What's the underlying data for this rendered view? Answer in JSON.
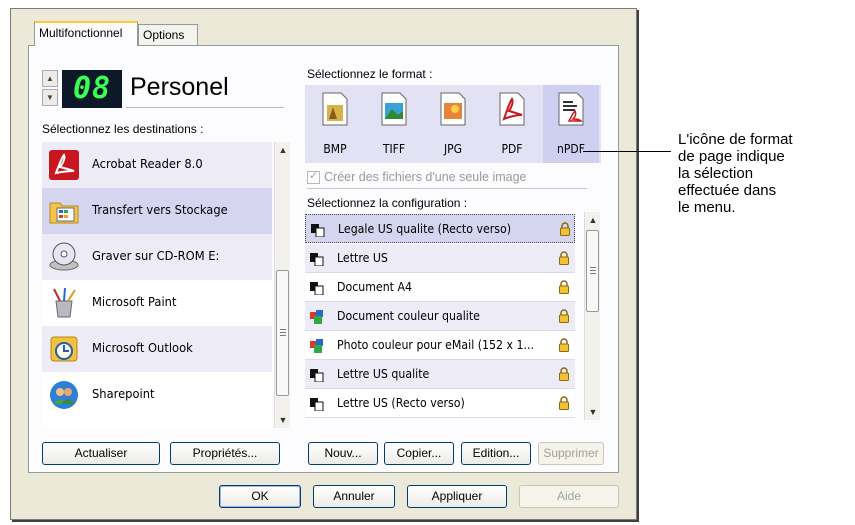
{
  "tabs": [
    "Multifonctionnel",
    "Options"
  ],
  "profile": {
    "number": "08",
    "name": "Personel"
  },
  "destinations": {
    "label": "Sélectionnez les destinations :",
    "items": [
      {
        "label": "Acrobat Reader 8.0",
        "icon": "acrobat-reader-icon"
      },
      {
        "label": "Transfert vers Stockage",
        "icon": "transfer-to-storage-icon"
      },
      {
        "label": "Graver sur CD-ROM  E:",
        "icon": "cd-burner-icon"
      },
      {
        "label": "Microsoft Paint",
        "icon": "paint-icon"
      },
      {
        "label": "Microsoft Outlook",
        "icon": "outlook-icon"
      },
      {
        "label": "Sharepoint",
        "icon": "sharepoint-icon"
      }
    ],
    "selected": "Transfert vers Stockage"
  },
  "format": {
    "label": "Sélectionnez le format :",
    "items": [
      "BMP",
      "TIFF",
      "JPG",
      "PDF",
      "nPDF"
    ],
    "selected": "nPDF"
  },
  "single_image_checkbox": {
    "label": "Créer des fichiers d'une seule image",
    "checked": true,
    "enabled": false
  },
  "configuration": {
    "label": "Sélectionnez la configuration :",
    "items": [
      {
        "label": "Legale US qualite (Recto verso)",
        "icon": "bw-doc-icon"
      },
      {
        "label": "Lettre US",
        "icon": "bw-doc-icon"
      },
      {
        "label": "Document A4",
        "icon": "bw-doc-icon"
      },
      {
        "label": "Document couleur qualite",
        "icon": "color-doc-icon"
      },
      {
        "label": "Photo couleur pour eMail (152 x 1...",
        "icon": "color-doc-icon"
      },
      {
        "label": "Lettre US qualite",
        "icon": "bw-doc-icon"
      },
      {
        "label": "Lettre US (Recto verso)",
        "icon": "bw-doc-icon"
      }
    ],
    "selected": "Legale US qualite (Recto verso)"
  },
  "buttons": {
    "refresh": "Actualiser",
    "properties": "Propriétés...",
    "new": "Nouv...",
    "copy": "Copier...",
    "edit": "Edition...",
    "delete": "Supprimer",
    "ok": "OK",
    "cancel": "Annuler",
    "apply": "Appliquer",
    "help": "Aide"
  },
  "callout": [
    "L'icône de format",
    "de page indique",
    "la sélection",
    "effectuée dans",
    "le menu."
  ],
  "colors": {
    "lcd_bg": "#0d1828",
    "lcd_digits": "#39ff54",
    "selection": "#d6d5f0",
    "alt_row": "#ecebf6"
  }
}
